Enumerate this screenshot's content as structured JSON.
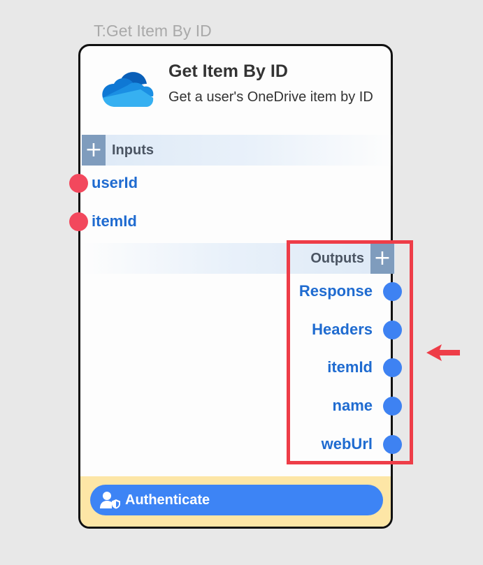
{
  "node": {
    "caption": "T:Get Item By ID",
    "title": "Get Item By ID",
    "description": "Get a user's OneDrive item by ID",
    "icon": "onedrive-icon"
  },
  "inputs": {
    "label": "Inputs",
    "plus": "+",
    "ports": [
      "userId",
      "itemId"
    ]
  },
  "outputs": {
    "label": "Outputs",
    "plus": "+",
    "ports": [
      "Response",
      "Headers",
      "itemId",
      "name",
      "webUrl"
    ]
  },
  "footer": {
    "auth_label": "Authenticate",
    "auth_icon": "user-shield-icon"
  },
  "colors": {
    "input_port": "#f2485d",
    "output_port": "#3e82f2",
    "port_label": "#1f6bd0",
    "highlight": "#ee3d48",
    "footer_bg": "#fde6a6",
    "auth_button": "#3d84f5"
  }
}
